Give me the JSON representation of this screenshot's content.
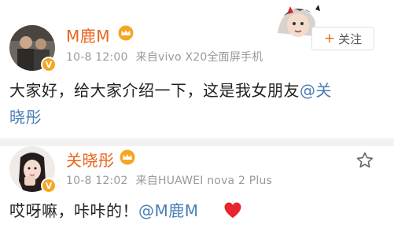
{
  "post1": {
    "author": "M鹿M",
    "time": "10-8 12:00",
    "source": "来自vivo X20全面屏手机",
    "content_line1": "大家好，给大家介绍一下，这是我女朋友",
    "mention_part1": "@关",
    "content_line2": "晓彤",
    "follow_label": "关注",
    "follow_plus": "+"
  },
  "post2": {
    "author": "关晓彤",
    "time": "10-8 12:02",
    "source": "来自HUAWEI nova 2 Plus",
    "content": "哎呀嘛，咔咔的！",
    "mention": "@M鹿M"
  },
  "badge": {
    "verified_letter": "V"
  },
  "icons": {
    "crown": "vip-crown-icon",
    "star": "star-outline-icon",
    "heart": "red-heart-icon",
    "verified": "verified-v-icon"
  },
  "colors": {
    "username": "#e8641c",
    "mention": "#4a7db5",
    "meta": "#9a9a9a",
    "heart": "#e8242c",
    "badge": "#f5a623"
  }
}
